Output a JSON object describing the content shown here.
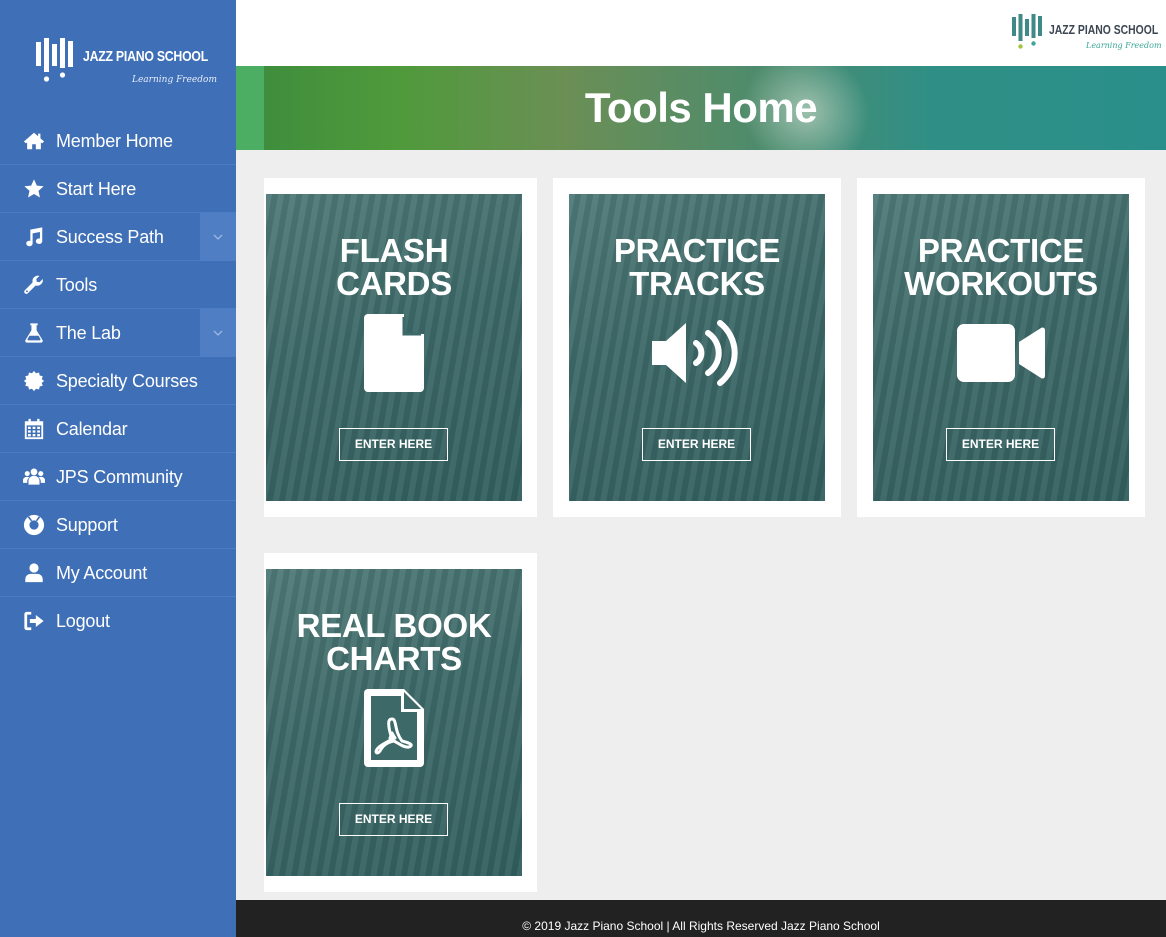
{
  "brand": {
    "name": "JAZZ PIANO SCHOOL",
    "tagline": "Learning Freedom"
  },
  "sidebar": {
    "items": [
      {
        "label": "Member Home",
        "icon": "home-icon",
        "has_toggle": false
      },
      {
        "label": "Start Here",
        "icon": "star-icon",
        "has_toggle": false
      },
      {
        "label": "Success Path",
        "icon": "music-note-icon",
        "has_toggle": true
      },
      {
        "label": "Tools",
        "icon": "wrench-icon",
        "has_toggle": false
      },
      {
        "label": "The Lab",
        "icon": "flask-icon",
        "has_toggle": true
      },
      {
        "label": "Specialty Courses",
        "icon": "badge-icon",
        "has_toggle": false
      },
      {
        "label": "Calendar",
        "icon": "calendar-icon",
        "has_toggle": false
      },
      {
        "label": "JPS Community",
        "icon": "users-icon",
        "has_toggle": false
      },
      {
        "label": "Support",
        "icon": "lifebuoy-icon",
        "has_toggle": false
      },
      {
        "label": "My Account",
        "icon": "user-icon",
        "has_toggle": false
      },
      {
        "label": "Logout",
        "icon": "sign-out-icon",
        "has_toggle": false
      }
    ]
  },
  "banner": {
    "title": "Tools Home"
  },
  "cards": [
    {
      "line1": "FLASH",
      "line2": "CARDS",
      "icon": "file-icon",
      "button": "ENTER HERE"
    },
    {
      "line1": "PRACTICE",
      "line2": "TRACKS",
      "icon": "volume-icon",
      "button": "ENTER HERE"
    },
    {
      "line1": "PRACTICE",
      "line2": "WORKOUTS",
      "icon": "video-camera-icon",
      "button": "ENTER HERE"
    },
    {
      "line1": "REAL BOOK",
      "line2": "CHARTS",
      "icon": "pdf-file-icon",
      "button": "ENTER HERE"
    }
  ],
  "footer": {
    "text": "© 2019 Jazz Piano School | All Rights Reserved Jazz Piano School"
  },
  "colors": {
    "sidebar": "#3f6fb6",
    "card": "#3d6968",
    "footer": "#222222",
    "page": "#eeeeee"
  }
}
